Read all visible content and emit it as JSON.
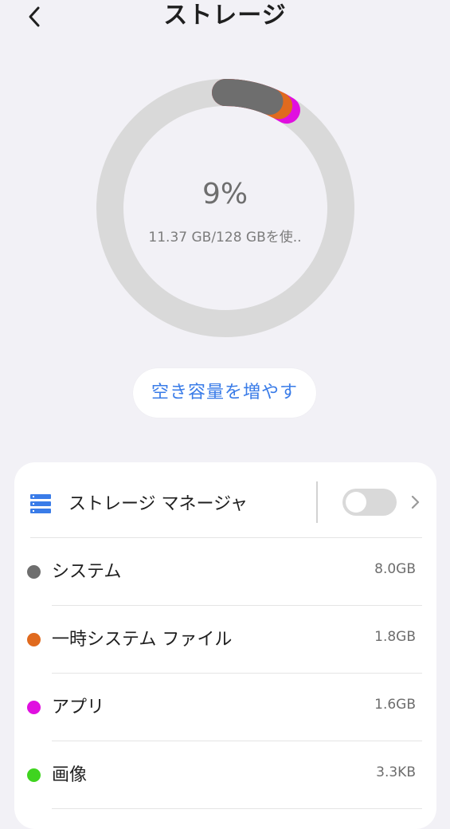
{
  "header": {
    "title": "ストレージ"
  },
  "summary": {
    "percent": "9%",
    "used_text": "11.37 GB/128 GBを使..",
    "used_gb": 11.37,
    "total_gb": 128
  },
  "donut": {
    "track_color": "#d9d9d9",
    "segments": [
      {
        "name": "システム",
        "gb": 8.0,
        "color": "#6e6e6e"
      },
      {
        "name": "一時システム ファイル",
        "gb": 1.8,
        "color": "#e06a1e"
      },
      {
        "name": "アプリ",
        "gb": 1.6,
        "color": "#e00fe0"
      }
    ]
  },
  "free_button": {
    "label": "空き容量を増やす"
  },
  "manager": {
    "label": "ストレージ マネージャ",
    "toggle_on": false
  },
  "items": [
    {
      "label": "システム",
      "size": "8.0GB",
      "color": "#6e6e6e"
    },
    {
      "label": "一時システム ファイル",
      "size": "1.8GB",
      "color": "#e06a1e"
    },
    {
      "label": "アプリ",
      "size": "1.6GB",
      "color": "#e00fe0"
    },
    {
      "label": "画像",
      "size": "3.3KB",
      "color": "#3fd41f"
    }
  ],
  "icons": {
    "back": "chevron-left-icon",
    "manager": "storage-list-icon",
    "chevron": "chevron-right-icon"
  }
}
